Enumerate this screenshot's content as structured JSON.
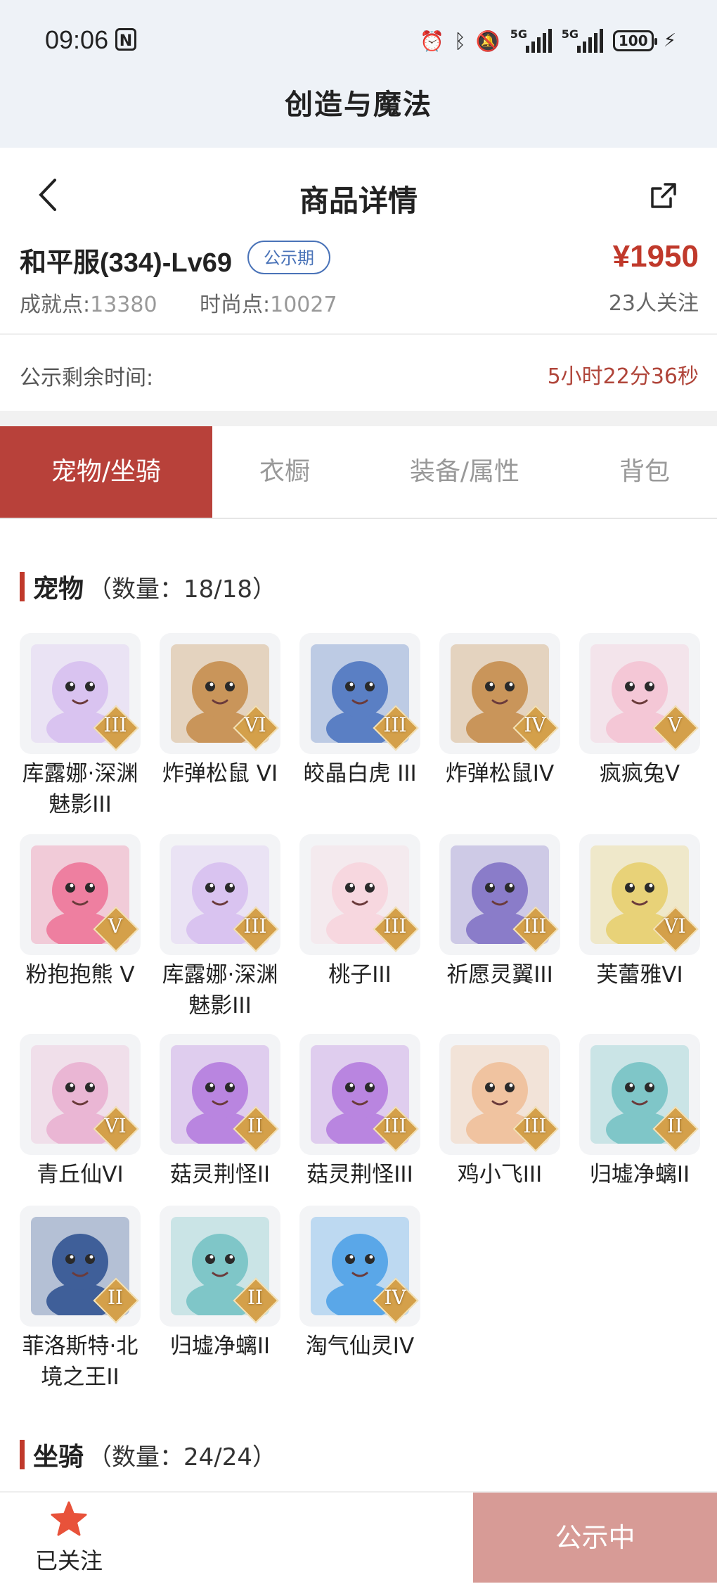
{
  "status_bar": {
    "time": "09:06",
    "nfc": "N",
    "battery": "100",
    "signal_1": "5G",
    "signal_2": "5G"
  },
  "app": {
    "title": "创造与魔法"
  },
  "nav": {
    "title": "商品详情"
  },
  "product": {
    "name": "和平服(334)-Lv69",
    "badge": "公示期",
    "price": "¥1950",
    "achievement_label": "成就点:",
    "achievement_value": "13380",
    "fashion_label": "时尚点:",
    "fashion_value": "10027",
    "followers": "23人关注"
  },
  "remaining": {
    "label": "公示剩余时间:",
    "value": "5小时22分36秒"
  },
  "tabs": [
    "宠物/坐骑",
    "衣橱",
    "装备/属性",
    "背包"
  ],
  "pets_section": {
    "title": "宠物",
    "count": "（数量：18/18）"
  },
  "pets": [
    {
      "name": "库露娜·深渊魅影III",
      "rank": "III",
      "color": "#d9c3f0"
    },
    {
      "name": "炸弹松鼠 VI",
      "rank": "VI",
      "color": "#c9955a"
    },
    {
      "name": "皎晶白虎 III",
      "rank": "III",
      "color": "#5a7fc4"
    },
    {
      "name": "炸弹松鼠IV",
      "rank": "IV",
      "color": "#c9955a"
    },
    {
      "name": "疯疯兔V",
      "rank": "V",
      "color": "#f4c7d6"
    },
    {
      "name": "粉抱抱熊 V",
      "rank": "V",
      "color": "#ee7fa0"
    },
    {
      "name": "库露娜·深渊魅影III",
      "rank": "III",
      "color": "#d9c3f0"
    },
    {
      "name": "桃子III",
      "rank": "III",
      "color": "#f7d7df"
    },
    {
      "name": "祈愿灵翼III",
      "rank": "III",
      "color": "#8a7cc9"
    },
    {
      "name": "芙蕾雅VI",
      "rank": "VI",
      "color": "#e8d278"
    },
    {
      "name": "青丘仙VI",
      "rank": "VI",
      "color": "#eab6d4"
    },
    {
      "name": "菇灵荆怪II",
      "rank": "II",
      "color": "#b985e0"
    },
    {
      "name": "菇灵荆怪III",
      "rank": "III",
      "color": "#b985e0"
    },
    {
      "name": "鸡小飞III",
      "rank": "III",
      "color": "#f0c3a0"
    },
    {
      "name": "归墟净螭II",
      "rank": "II",
      "color": "#7fc6c8"
    },
    {
      "name": "菲洛斯特·北境之王II",
      "rank": "II",
      "color": "#3f5f99"
    },
    {
      "name": "归墟净螭II",
      "rank": "II",
      "color": "#7fc6c8"
    },
    {
      "name": "淘气仙灵IV",
      "rank": "IV",
      "color": "#5aa7e8"
    }
  ],
  "mounts_section": {
    "title": "坐骑",
    "count": "（数量：24/24）"
  },
  "bottom_bar": {
    "follow_label": "已关注",
    "cta": "公示中"
  }
}
